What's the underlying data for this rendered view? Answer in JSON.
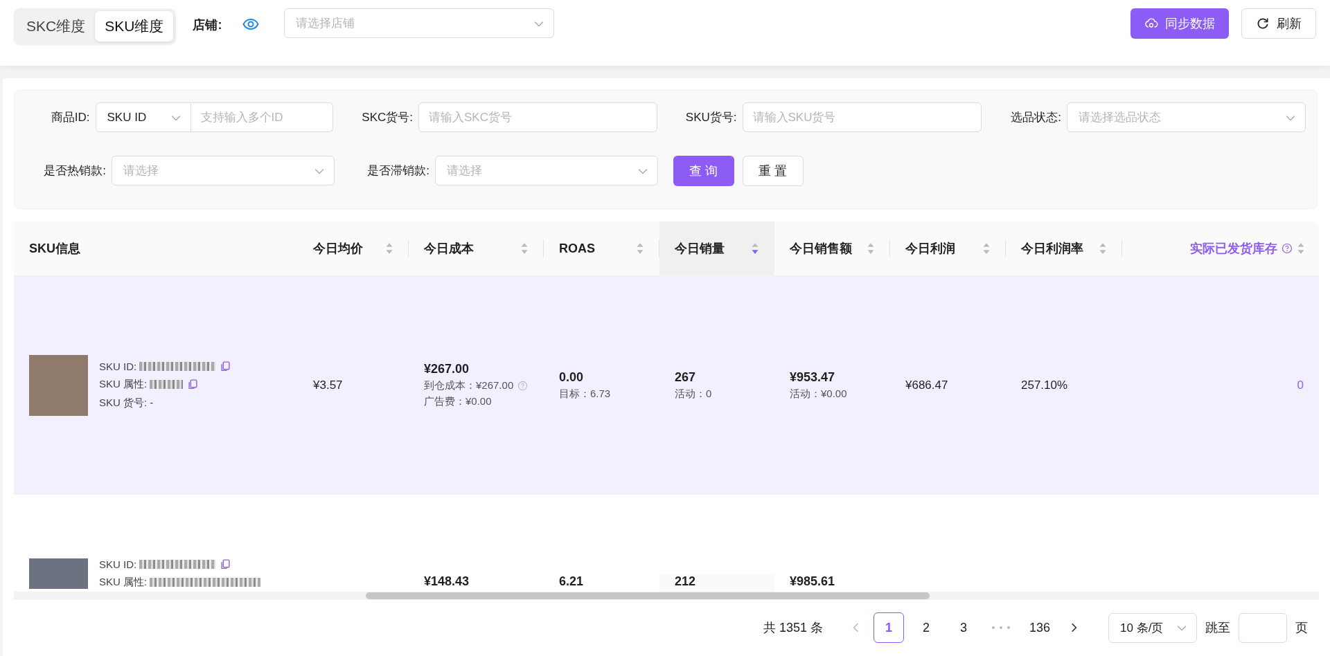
{
  "dimension_tabs": [
    {
      "label": "SKC维度",
      "selected": false
    },
    {
      "label": "SKU维度",
      "selected": true
    }
  ],
  "store_filter": {
    "label": "店铺:",
    "placeholder": "请选择店铺"
  },
  "actions": [
    {
      "kind": "primary",
      "label": "同步数据"
    },
    {
      "kind": "default",
      "label": "刷新"
    }
  ],
  "filters": [
    {
      "kind": "select-input",
      "label": "商品ID:",
      "value": "SKU ID",
      "placeholder": "支持输入多个ID"
    },
    {
      "kind": "input",
      "label": "SKC货号:",
      "placeholder": "请输入SKC货号"
    },
    {
      "kind": "input",
      "label": "SKU货号:",
      "placeholder": "请输入SKU货号"
    },
    {
      "kind": "select",
      "label": "选品状态:",
      "placeholder": "请选择选品状态"
    },
    {
      "kind": "select",
      "label": "是否热销款:",
      "placeholder": "请选择"
    },
    {
      "kind": "select",
      "label": "是否滞销款:",
      "placeholder": "请选择"
    }
  ],
  "filter_buttons": [
    {
      "kind": "primary",
      "label": "查 询"
    },
    {
      "kind": "default",
      "label": "重 置"
    }
  ],
  "table": {
    "columns": [
      {
        "label": "SKU信息"
      },
      {
        "label": "今日均价",
        "sorted": false
      },
      {
        "label": "今日成本",
        "sorted": false
      },
      {
        "label": "ROAS",
        "sorted": false
      },
      {
        "label": "今日销量",
        "sorted": true
      },
      {
        "label": "今日销售额",
        "sorted": false
      },
      {
        "label": "今日利润",
        "sorted": false
      },
      {
        "label": "今日利润率",
        "sorted": false
      },
      {
        "label": "实际已发货库存",
        "sorted": false,
        "help": true
      }
    ],
    "rows": [
      {
        "selected": true,
        "cells": [
          {
            "kind": "sku",
            "sku_info": [
              {
                "label": "SKU ID:",
                "redacted": true,
                "copy": true
              },
              {
                "label": "SKU 属性:",
                "redacted": true,
                "copy": true
              },
              {
                "label": "SKU 货号: -"
              }
            ]
          },
          {
            "kind": "value",
            "text": "¥3.57"
          },
          {
            "kind": "stack",
            "main": "¥267.00",
            "sub": [
              {
                "text": "到仓成本：¥267.00",
                "help": true
              },
              {
                "text": "广告费：¥0.00"
              }
            ]
          },
          {
            "kind": "stack",
            "main": "0.00",
            "sub": [
              {
                "text": "目标：6.73"
              }
            ]
          },
          {
            "kind": "stack",
            "main": "267",
            "sub": [
              {
                "text": "活动：0"
              }
            ]
          },
          {
            "kind": "stack",
            "main": "¥953.47",
            "sub": [
              {
                "text": "活动：¥0.00"
              }
            ]
          },
          {
            "kind": "value",
            "text": "¥686.47"
          },
          {
            "kind": "value",
            "text": "257.10%"
          },
          {
            "kind": "link",
            "text": "0"
          }
        ]
      },
      {
        "selected": false,
        "cells": [
          {
            "kind": "sku",
            "sku_info": [
              {
                "label": "SKU ID:",
                "redacted": true,
                "copy": true
              },
              {
                "label": "SKU 属性:",
                "redacted": true,
                "copy": false
              }
            ]
          },
          {
            "kind": "blank"
          },
          {
            "kind": "stack",
            "main": "¥148.43"
          },
          {
            "kind": "stack",
            "main": "6.21"
          },
          {
            "kind": "stack",
            "main": "212"
          },
          {
            "kind": "stack",
            "main": "¥985.61"
          },
          {
            "kind": "blank"
          },
          {
            "kind": "blank"
          },
          {
            "kind": "blank"
          }
        ]
      }
    ]
  },
  "pagination": {
    "total": "共 1351 条",
    "pages": [
      {
        "kind": "page",
        "label": "1",
        "selected": true
      },
      {
        "kind": "page",
        "label": "2",
        "selected": false
      },
      {
        "kind": "page",
        "label": "3",
        "selected": false
      },
      {
        "kind": "ellipsis"
      },
      {
        "kind": "page",
        "label": "136",
        "selected": false
      }
    ],
    "page_size": "10 条/页",
    "jump_label": "跳至",
    "page_suffix": "页"
  }
}
